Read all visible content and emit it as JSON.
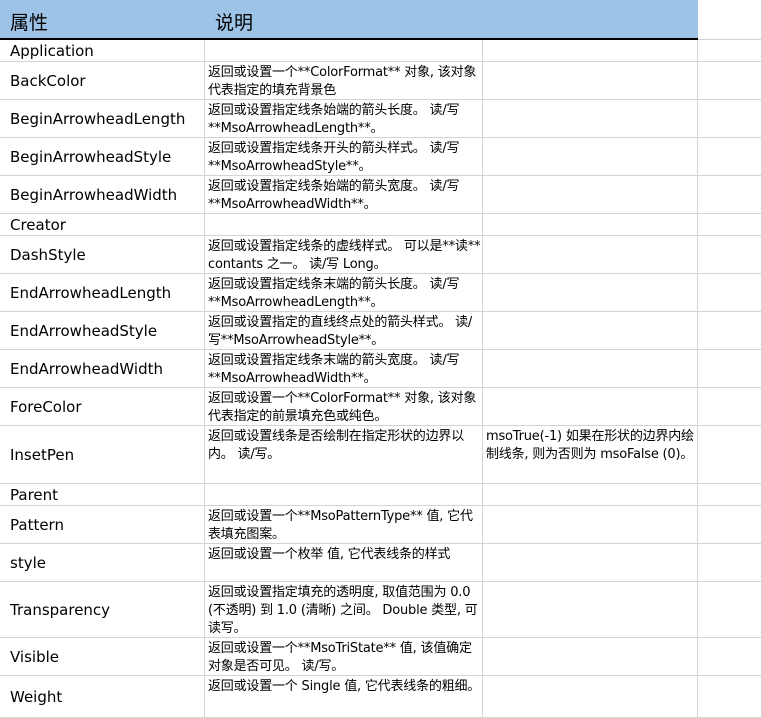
{
  "header": {
    "col_property": "属性",
    "col_description": "说明",
    "col_extra": ""
  },
  "rows": [
    {
      "property": "Application",
      "description": "",
      "extra": ""
    },
    {
      "property": "BackColor",
      "description": "返回或设置一个**ColorFormat** 对象, 该对象代表指定的填充背景色",
      "extra": ""
    },
    {
      "property": "BeginArrowheadLength",
      "description": "返回或设置指定线条始端的箭头长度。 读/写**MsoArrowheadLength**。",
      "extra": ""
    },
    {
      "property": "BeginArrowheadStyle",
      "description": "返回或设置指定线条开头的箭头样式。 读/写**MsoArrowheadStyle**。",
      "extra": ""
    },
    {
      "property": "BeginArrowheadWidth",
      "description": "返回或设置指定线条始端的箭头宽度。 读/写**MsoArrowheadWidth**。",
      "extra": ""
    },
    {
      "property": "Creator",
      "description": "",
      "extra": ""
    },
    {
      "property": "DashStyle",
      "description": "返回或设置指定线条的虚线样式。 可以是**读** contants 之一。 读/写 Long。",
      "extra": ""
    },
    {
      "property": "EndArrowheadLength",
      "description": "返回或设置指定线条末端的箭头长度。 读/写**MsoArrowheadLength**。",
      "extra": ""
    },
    {
      "property": "EndArrowheadStyle",
      "description": "返回或设置指定的直线终点处的箭头样式。 读/写**MsoArrowheadStyle**。",
      "extra": ""
    },
    {
      "property": "EndArrowheadWidth",
      "description": "返回或设置指定线条末端的箭头宽度。 读/写**MsoArrowheadWidth**。",
      "extra": ""
    },
    {
      "property": "ForeColor",
      "description": "返回或设置一个**ColorFormat** 对象, 该对象代表指定的前景填充色或纯色。",
      "extra": ""
    },
    {
      "property": "InsetPen",
      "description": "返回或设置线条是否绘制在指定形状的边界以内。 读/写。",
      "extra": "msoTrue(-1) 如果在形状的边界内绘制线条, 则为否则为 msoFalse (0)。"
    },
    {
      "property": "Parent",
      "description": "",
      "extra": ""
    },
    {
      "property": "Pattern",
      "description": "返回或设置一个**MsoPatternType** 值, 它代表填充图案。",
      "extra": ""
    },
    {
      "property": "style",
      "description": "返回或设置一个枚举 值, 它代表线条的样式",
      "extra": ""
    },
    {
      "property": "Transparency",
      "description": "返回或设置指定填充的透明度, 取值范围为 0.0 (不透明) 到 1.0 (清晰) 之间。 Double 类型, 可读写。",
      "extra": ""
    },
    {
      "property": "Visible",
      "description": "返回或设置一个**MsoTriState** 值, 该值确定对象是否可见。 读/写。",
      "extra": ""
    },
    {
      "property": "Weight",
      "description": "返回或设置一个 Single 值, 它代表线条的粗细。",
      "extra": ""
    }
  ]
}
